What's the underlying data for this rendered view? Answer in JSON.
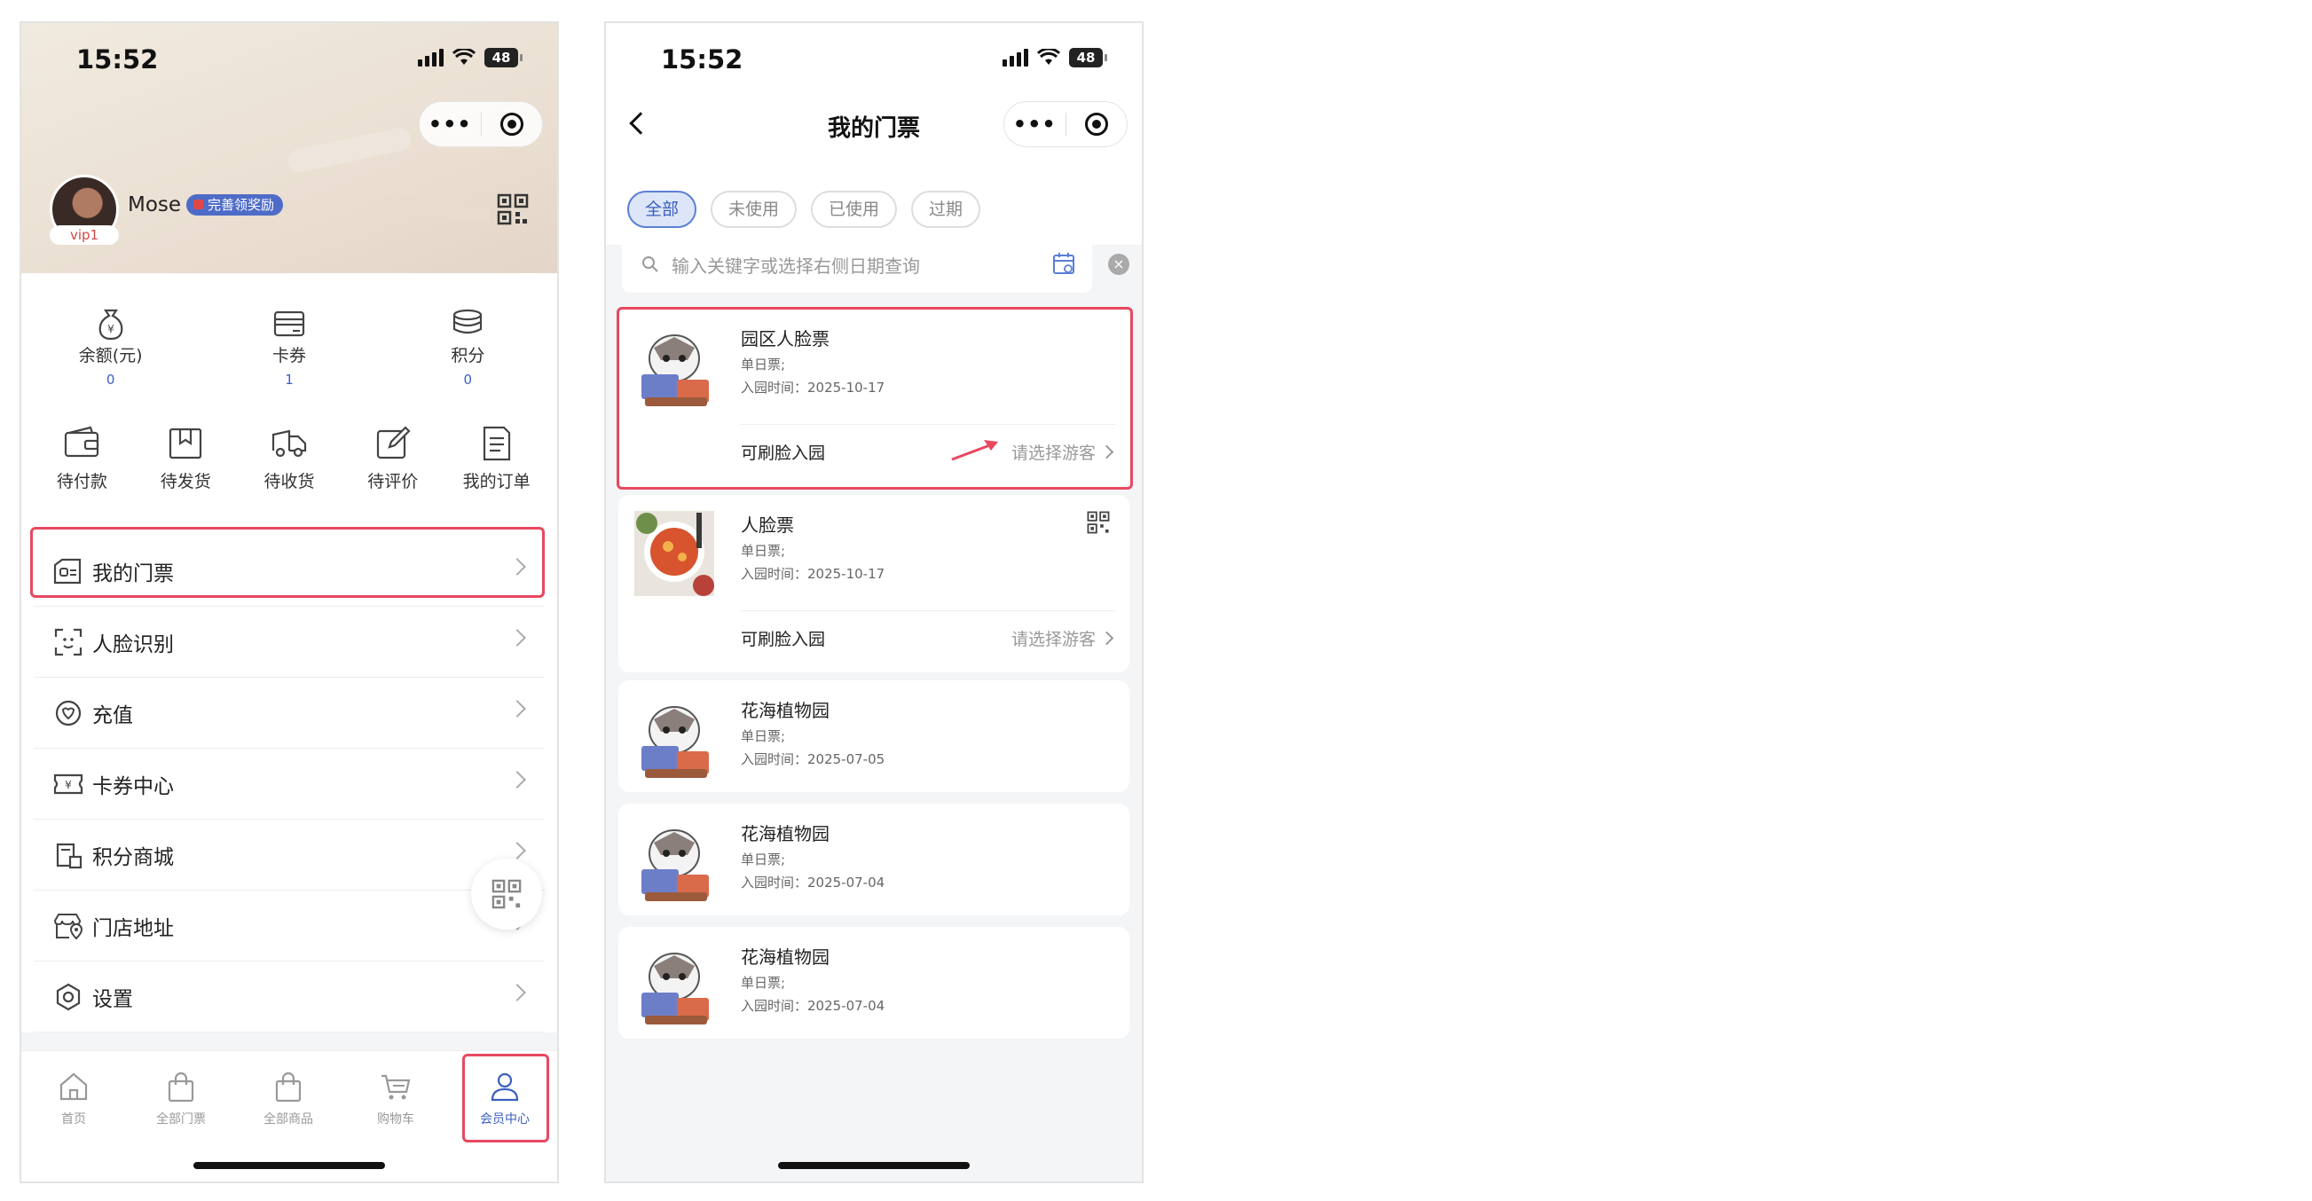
{
  "status_bar": {
    "time": "15:52",
    "battery": "48"
  },
  "capsule": {
    "menu_icon": "more-dots-icon",
    "close_icon": "target-icon"
  },
  "member_center": {
    "user": {
      "name": "Mose",
      "vip_level": "vip1",
      "reward_badge": "完善领奖励"
    },
    "assets": [
      {
        "label": "余额(元)",
        "value": "0",
        "icon": "money-bag-icon"
      },
      {
        "label": "卡券",
        "value": "1",
        "icon": "card-icon"
      },
      {
        "label": "积分",
        "value": "0",
        "icon": "coins-icon"
      }
    ],
    "orders": [
      {
        "label": "待付款",
        "icon": "wallet-icon"
      },
      {
        "label": "待发货",
        "icon": "box-icon"
      },
      {
        "label": "待收货",
        "icon": "truck-icon"
      },
      {
        "label": "待评价",
        "icon": "edit-icon"
      },
      {
        "label": "我的订单",
        "icon": "document-icon"
      }
    ],
    "menu": [
      {
        "label": "我的门票",
        "icon": "ticket-icon"
      },
      {
        "label": "人脸识别",
        "icon": "face-scan-icon"
      },
      {
        "label": "充值",
        "icon": "recharge-icon"
      },
      {
        "label": "卡券中心",
        "icon": "coupon-icon"
      },
      {
        "label": "积分商城",
        "icon": "points-mall-icon"
      },
      {
        "label": "门店地址",
        "icon": "store-location-icon"
      },
      {
        "label": "设置",
        "icon": "settings-icon"
      }
    ],
    "tabbar": [
      {
        "label": "首页",
        "icon": "home-icon"
      },
      {
        "label": "全部门票",
        "icon": "bag-icon"
      },
      {
        "label": "全部商品",
        "icon": "bag-icon"
      },
      {
        "label": "购物车",
        "icon": "cart-icon"
      },
      {
        "label": "会员中心",
        "icon": "user-icon",
        "active": true
      }
    ]
  },
  "my_tickets": {
    "title": "我的门票",
    "filters": [
      {
        "label": "全部",
        "active": true
      },
      {
        "label": "未使用",
        "active": false
      },
      {
        "label": "已使用",
        "active": false
      },
      {
        "label": "过期",
        "active": false
      }
    ],
    "search": {
      "placeholder": "输入关键字或选择右侧日期查询"
    },
    "tickets": [
      {
        "name": "园区人脸票",
        "type": "单日票;",
        "date": "入园时间：2025-10-17",
        "face_entry": "可刷脸入园",
        "guest_action": "请选择游客",
        "thumb": "mascot"
      },
      {
        "name": "人脸票",
        "type": "单日票;",
        "date": "入园时间：2025-10-17",
        "face_entry": "可刷脸入园",
        "guest_action": "请选择游客",
        "thumb": "food"
      },
      {
        "name": "花海植物园",
        "type": "单日票;",
        "date": "入园时间：2025-07-05",
        "thumb": "mascot"
      },
      {
        "name": "花海植物园",
        "type": "单日票;",
        "date": "入园时间：2025-07-04",
        "thumb": "mascot"
      },
      {
        "name": "花海植物园",
        "type": "单日票;",
        "date": "入园时间：2025-07-04",
        "thumb": "mascot"
      }
    ]
  },
  "colors": {
    "accent": "#3a5fbf",
    "highlight": "#e84860"
  }
}
